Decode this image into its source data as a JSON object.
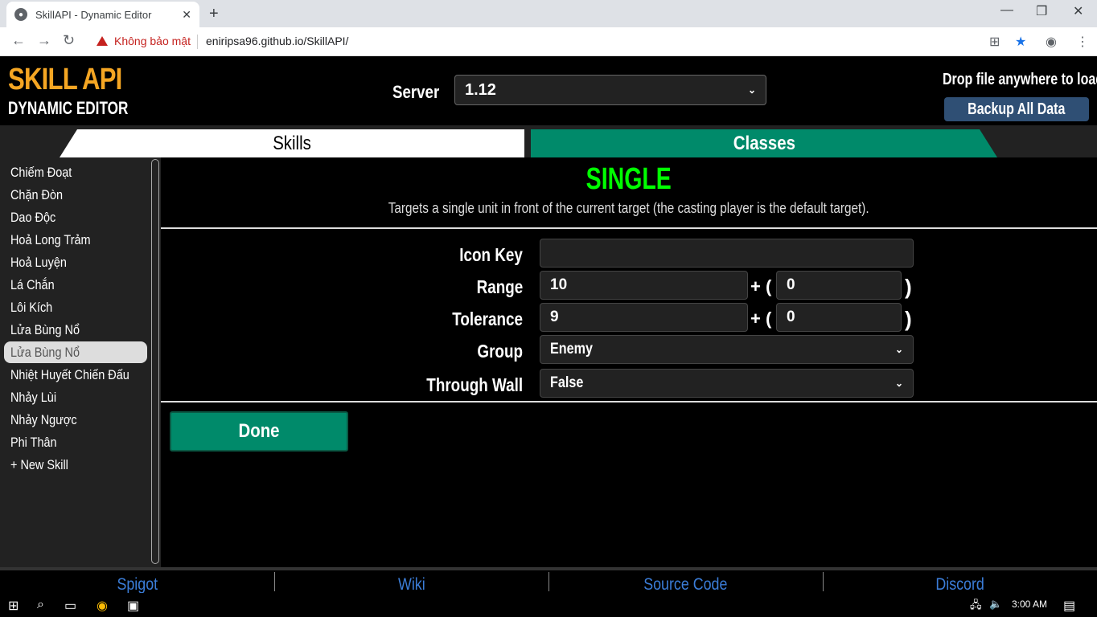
{
  "browser": {
    "tab_title": "SkillAPI - Dynamic Editor",
    "tab_close": "✕",
    "new_tab": "+",
    "security_label": "Không bảo mật",
    "url": "eniripsa96.github.io/SkillAPI/"
  },
  "header": {
    "logo_line1": "SKILL API",
    "logo_line2": "DYNAMIC EDITOR",
    "server_label": "Server",
    "server_value": "1.12",
    "drop_text": "Drop file anywhere to load",
    "backup_label": "Backup All Data"
  },
  "tabs": {
    "skills": "Skills",
    "classes": "Classes"
  },
  "sidebar": {
    "items": [
      {
        "label": "Chiếm Đoạt"
      },
      {
        "label": "Chặn Đòn"
      },
      {
        "label": "Dao Độc"
      },
      {
        "label": "Hoả Long Trảm"
      },
      {
        "label": "Hoả Luyện"
      },
      {
        "label": "Lá Chắn"
      },
      {
        "label": "Lôi Kích"
      },
      {
        "label": "Lửa Bùng Nổ"
      },
      {
        "label": "Lửa Bùng Nổ"
      },
      {
        "label": "Nhiệt Huyết Chiến Đấu"
      },
      {
        "label": "Nhảy Lùi"
      },
      {
        "label": "Nhảy Ngược"
      },
      {
        "label": "Phi Thân"
      },
      {
        "label": "+ New Skill"
      }
    ],
    "active_index": 8
  },
  "component": {
    "title": "SINGLE",
    "description": "Targets a single unit in front of the current target (the casting player is the default target).",
    "fields": {
      "icon_key": {
        "label": "Icon Key",
        "value": ""
      },
      "range": {
        "label": "Range",
        "base": "10",
        "scale": "0"
      },
      "tolerance": {
        "label": "Tolerance",
        "base": "9",
        "scale": "0"
      },
      "group": {
        "label": "Group",
        "value": "Enemy"
      },
      "through_wall": {
        "label": "Through Wall",
        "value": "False"
      }
    },
    "plus_paren": "+ (",
    "close_paren": ")",
    "done_label": "Done"
  },
  "footer": {
    "links": [
      "Spigot",
      "Wiki",
      "Source Code",
      "Discord"
    ]
  },
  "taskbar": {
    "clock": "3:00 AM"
  },
  "colors": {
    "accent_green": "#008a6a",
    "title_green": "#00ff00",
    "logo_orange": "#f5a623",
    "link_blue": "#3b7dd8"
  }
}
